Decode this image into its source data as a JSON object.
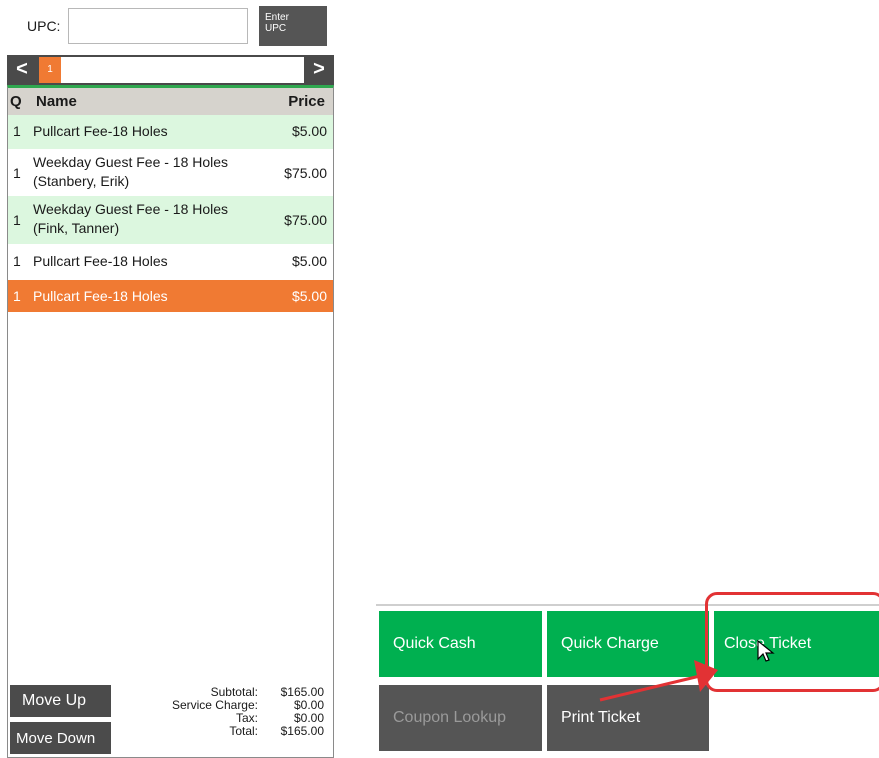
{
  "upc": {
    "label": "UPC:",
    "value": "",
    "enter_label_1": "Enter",
    "enter_label_2": "UPC"
  },
  "pager": {
    "prev_glyph": "<",
    "next_glyph": ">",
    "current_page": "1"
  },
  "ticket": {
    "headers": {
      "q": "Q",
      "name": "Name",
      "price": "Price"
    },
    "rows": [
      {
        "q": "1",
        "name_1": "Pullcart Fee-18 Holes",
        "name_2": "",
        "price": "$5.00",
        "style": "green",
        "selected": false
      },
      {
        "q": "1",
        "name_1": "Weekday Guest Fee - 18 Holes",
        "name_2": "(Stanbery, Erik)",
        "price": "$75.00",
        "style": "white",
        "selected": false
      },
      {
        "q": "1",
        "name_1": "Weekday Guest Fee - 18 Holes",
        "name_2": "(Fink, Tanner)",
        "price": "$75.00",
        "style": "green",
        "selected": false
      },
      {
        "q": "1",
        "name_1": "Pullcart Fee-18 Holes",
        "name_2": "",
        "price": "$5.00",
        "style": "white",
        "selected": false
      },
      {
        "q": "1",
        "name_1": "Pullcart Fee-18 Holes",
        "name_2": "",
        "price": "$5.00",
        "style": "selected",
        "selected": true
      }
    ],
    "move_up_label": "Move Up",
    "move_down_label": "Move Down",
    "totals": {
      "subtotal_label": "Subtotal:",
      "subtotal": "$165.00",
      "service_label": "Service Charge:",
      "service": "$0.00",
      "tax_label": "Tax:",
      "tax": "$0.00",
      "total_label": "Total:",
      "total": "$165.00"
    }
  },
  "actions": {
    "quick_cash": "Quick Cash",
    "quick_charge": "Quick Charge",
    "close_ticket": "Close Ticket",
    "coupon_lookup": "Coupon Lookup",
    "print_ticket": "Print Ticket"
  },
  "colors": {
    "green": "#00b050",
    "orange": "#f07a33",
    "dark": "#555555",
    "highlight": "#e23234"
  }
}
